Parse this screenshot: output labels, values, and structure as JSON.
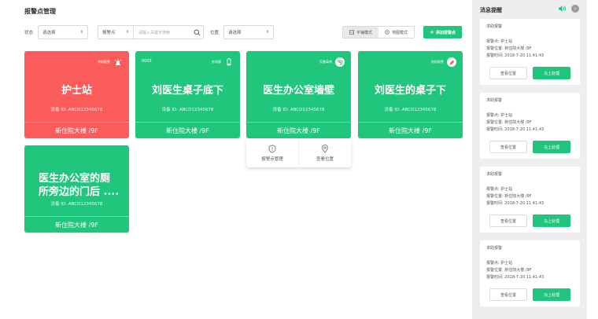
{
  "page": {
    "title": "报警点管理"
  },
  "filters": {
    "status_label": "状态",
    "status_value": "请选择",
    "search_type": "报警点",
    "search_placeholder": "请输入关键字搜索",
    "location_label": "位置",
    "location_value": "请选择"
  },
  "view_modes": [
    {
      "label": "平铺模式",
      "icon": "grid-icon",
      "active": true
    },
    {
      "label": "地图模式",
      "icon": "map-icon",
      "active": false
    }
  ],
  "add_button": {
    "icon": "plus-icon",
    "label": "添加报警点"
  },
  "cards": [
    {
      "id": "",
      "badge": "求助报警",
      "badge_icon": "siren-icon",
      "title": "护士站",
      "device": "设备 ID: ABCD12345678",
      "location": "新住院大楼 /9F",
      "color": "#fa5b5b"
    },
    {
      "id": "0003",
      "badge": "低电量",
      "badge_icon": "battery-icon",
      "title": "刘医生桌子底下",
      "device": "设备 ID: ABCD12345678",
      "location": "新住院大楼 /9F",
      "color": "#1fc67c"
    },
    {
      "id": "",
      "badge": "设备离线",
      "badge_icon": "wifi-off-icon",
      "title": "医生办公室墙壁",
      "device": "设备 ID: ABCD12345678",
      "location": "新住院大楼 /9F",
      "color": "#1fc67c"
    },
    {
      "id": "",
      "badge": "防拆报警",
      "badge_icon": "tamper-icon",
      "title": "刘医生的桌子下",
      "device": "设备 ID: ABCD12345678",
      "location": "新住院大楼 /9F",
      "color": "#1fc67c"
    },
    {
      "id": "",
      "badge": "",
      "badge_icon": "",
      "title_line1": "医生办公室的厕",
      "title_line2": "所旁边的门后 ....",
      "device": "设备 ID: ABCD12345678",
      "location": "新住院大楼 /9F",
      "color": "#1fc67c"
    }
  ],
  "card_menu": [
    {
      "label": "报警点管理",
      "icon": "shield-alert-icon"
    },
    {
      "label": "查看位置",
      "icon": "location-pin-icon"
    }
  ],
  "panel": {
    "title": "消息提醒",
    "messages": [
      {
        "type": "求助报警",
        "point": "报警点: 护士站",
        "location": "报警位置: 新住院大楼 /9F",
        "time": "报警时间: 2018-7-20 11:41:43",
        "view_label": "查看位置",
        "handle_label": "马上处理"
      },
      {
        "type": "求助报警",
        "point": "报警点: 护士站",
        "location": "报警位置: 新住院大楼 /9F",
        "time": "报警时间: 2018-7-20 11:41:43",
        "view_label": "查看位置",
        "handle_label": "马上处理"
      },
      {
        "type": "求助报警",
        "point": "报警点: 护士站",
        "location": "报警位置: 新住院大楼 /9F",
        "time": "报警时间: 2018-7-20 11:41:43",
        "view_label": "查看位置",
        "handle_label": "马上处理"
      },
      {
        "type": "求助报警",
        "point": "报警点: 护士站",
        "location": "报警位置: 新住院大楼 /9F",
        "time": "报警时间: 2018-7-20 11:41:43",
        "view_label": "查看位置",
        "handle_label": "马上处理"
      }
    ]
  },
  "colors": {
    "accent": "#1fc67c",
    "alert": "#fa5b5b"
  }
}
